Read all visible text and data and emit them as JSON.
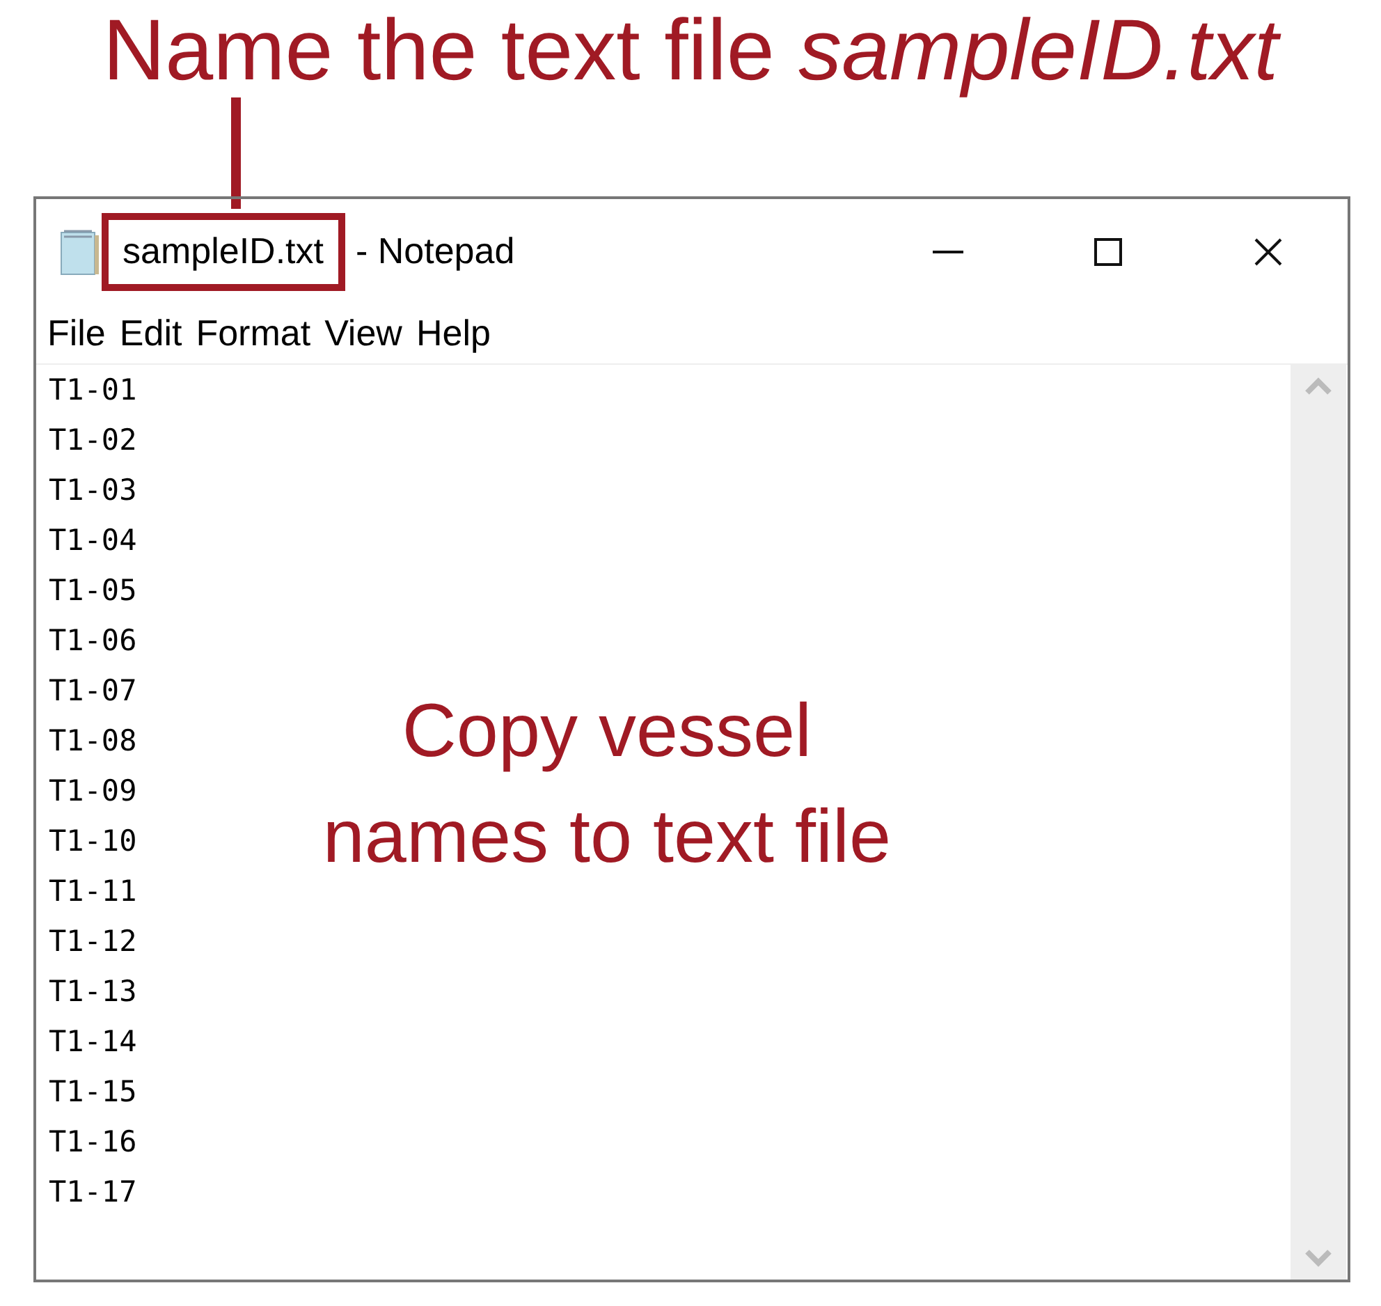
{
  "annotation": {
    "heading": "Name the text file *sampleID.txt*",
    "overlay": [
      "Copy vessel",
      "names to text file"
    ]
  },
  "window": {
    "file_name": "sampleID.txt",
    "app_name": "- Notepad"
  },
  "menu": [
    "File",
    "Edit",
    "Format",
    "View",
    "Help"
  ],
  "lines": [
    "T1-01",
    "T1-02",
    "T1-03",
    "T1-04",
    "T1-05",
    "T1-06",
    "T1-07",
    "T1-08",
    "T1-09",
    "T1-10",
    "T1-11",
    "T1-12",
    "T1-13",
    "T1-14",
    "T1-15",
    "T1-16",
    "T1-17"
  ]
}
